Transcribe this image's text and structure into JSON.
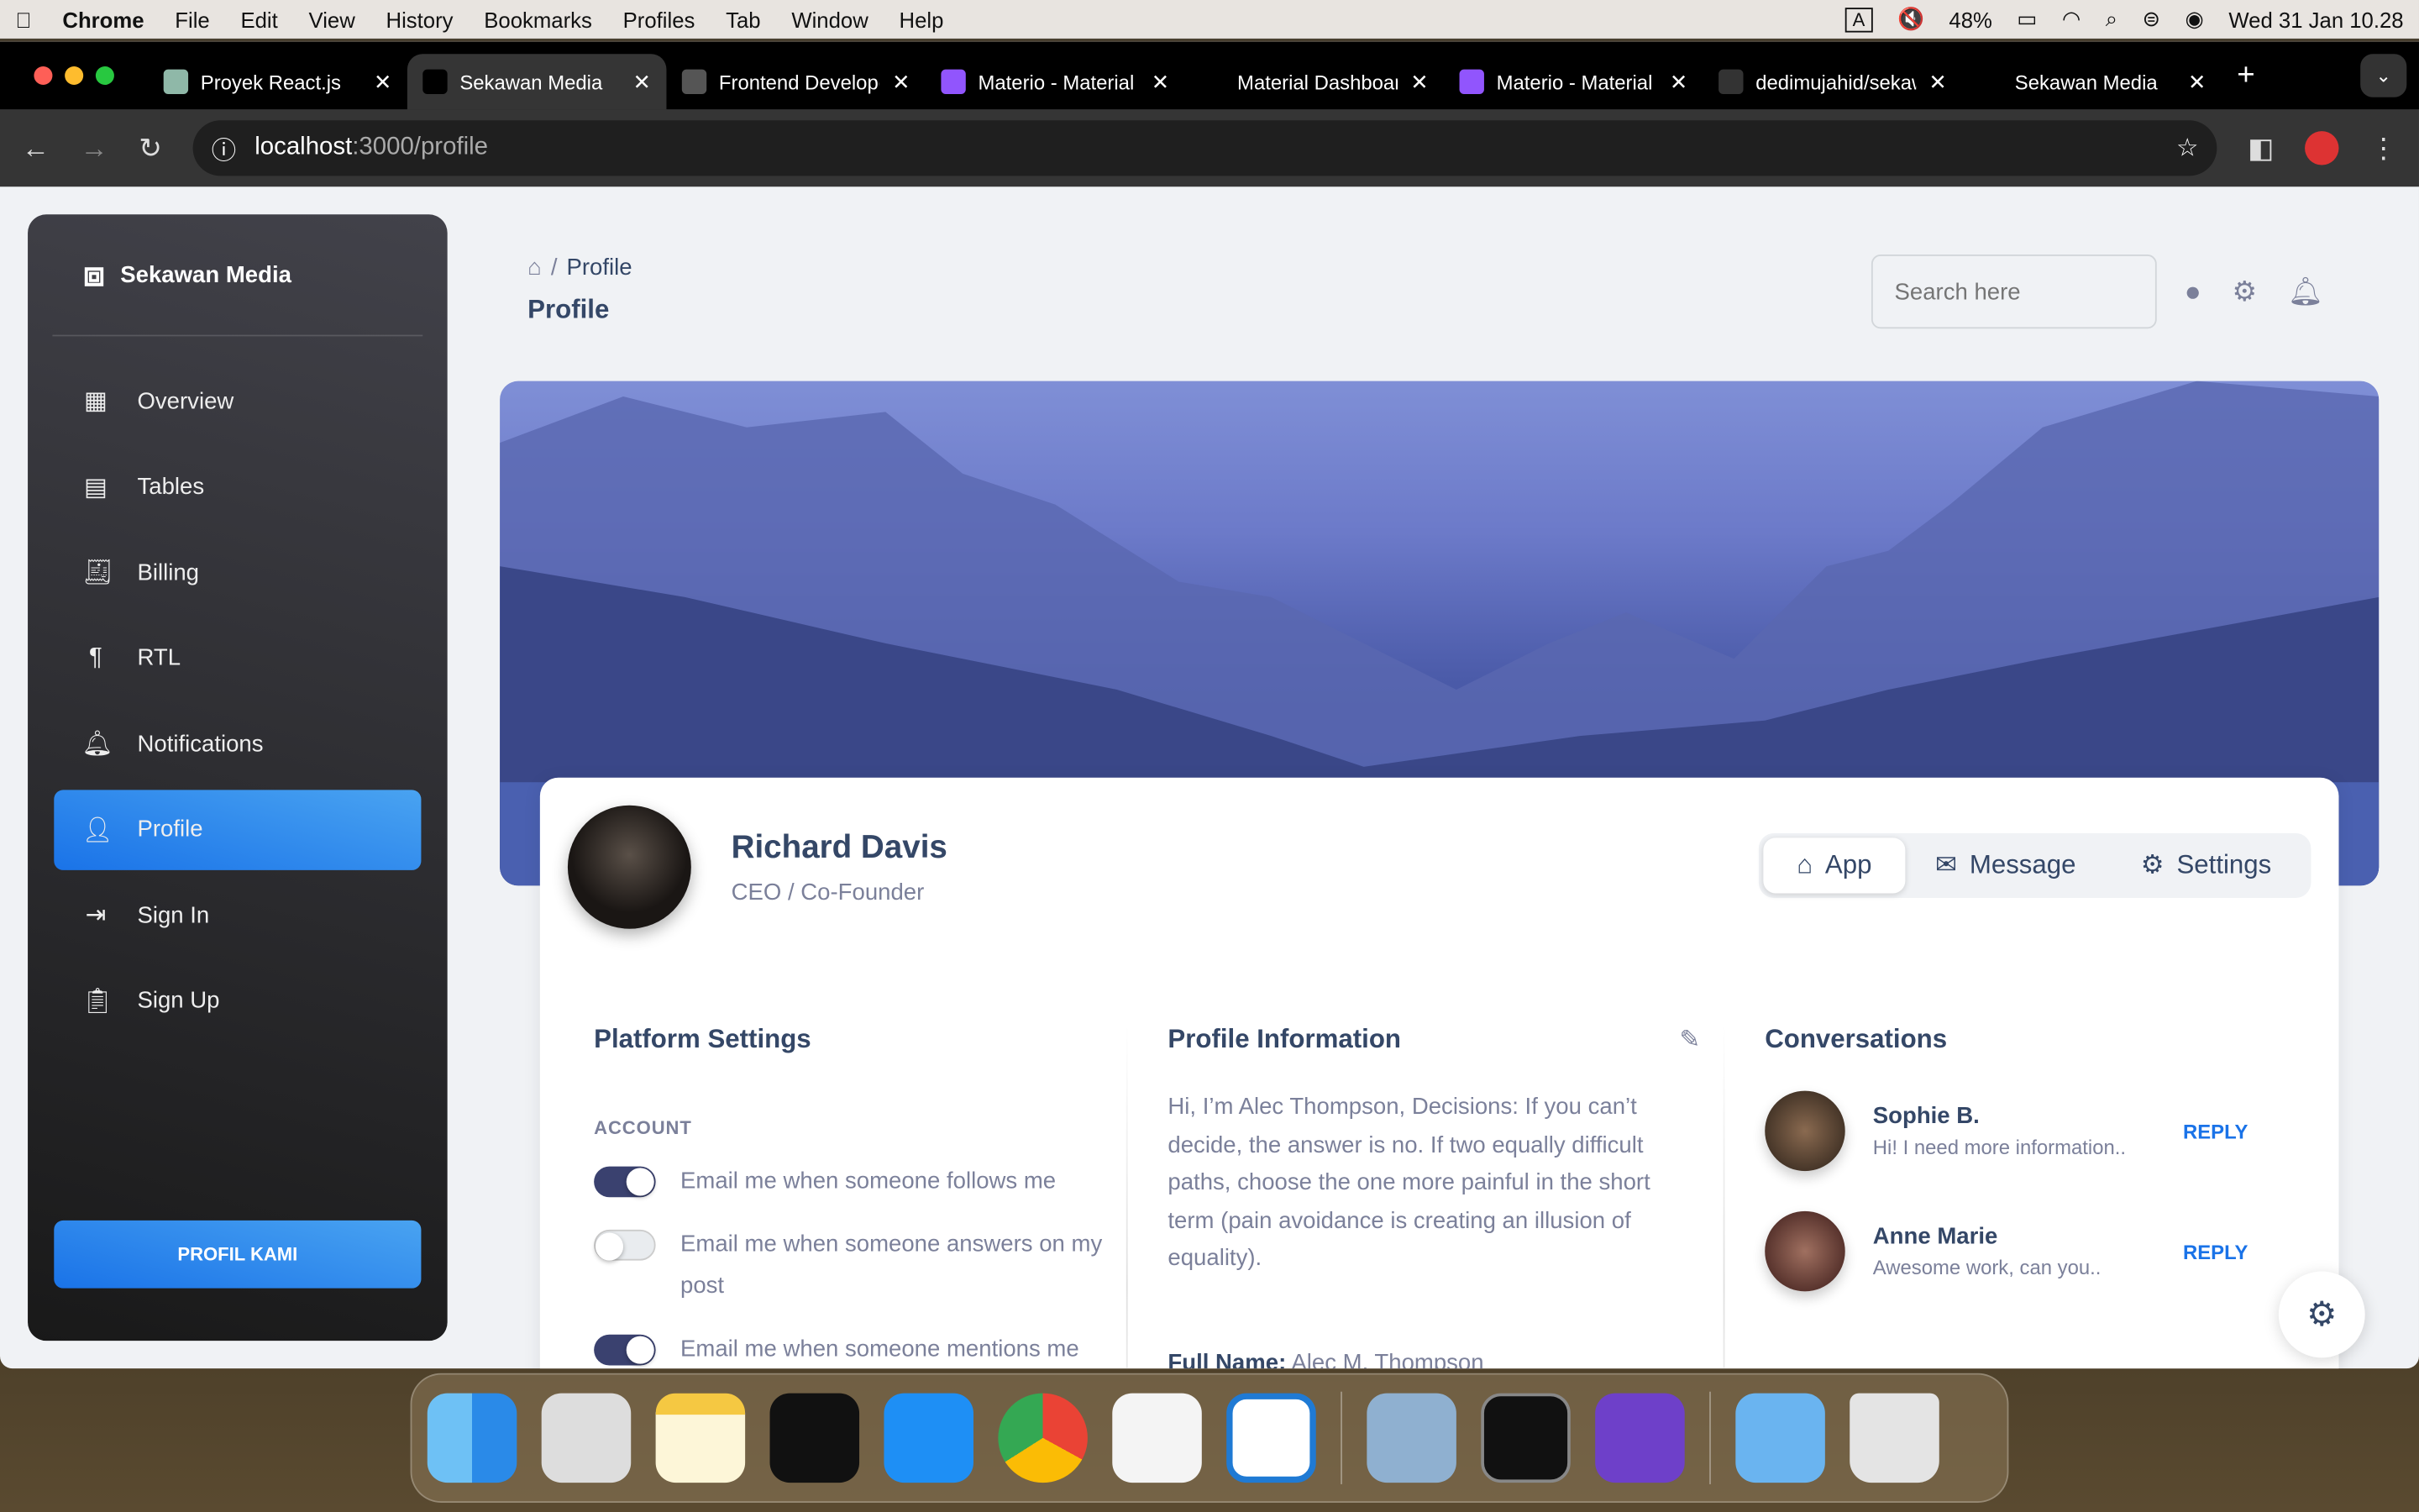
{
  "menubar": {
    "app": "Chrome",
    "items": [
      "File",
      "Edit",
      "View",
      "History",
      "Bookmarks",
      "Profiles",
      "Tab",
      "Window",
      "Help"
    ],
    "input_indicator": "A",
    "battery": "48%",
    "datetime": "Wed 31 Jan  10.28"
  },
  "browser": {
    "tabs": [
      {
        "label": "Proyek React.js",
        "color": "#8fb8a8"
      },
      {
        "label": "Sekawan Media",
        "color": "#000000",
        "active": true
      },
      {
        "label": "Frontend Developer",
        "color": "#555555"
      },
      {
        "label": "Materio - Material",
        "color": "#9155fd"
      },
      {
        "label": "Material Dashboard",
        "color": "#000000"
      },
      {
        "label": "Materio - Material",
        "color": "#9155fd"
      },
      {
        "label": "dedimujahid/sekawan",
        "color": "#333333"
      },
      {
        "label": "Sekawan Media",
        "color": "#000000"
      }
    ],
    "url_host": "localhost",
    "url_path": ":3000/profile"
  },
  "sidebar": {
    "brand": "Sekawan Media",
    "items": [
      {
        "label": "Overview",
        "icon": "dashboard-icon"
      },
      {
        "label": "Tables",
        "icon": "table-icon"
      },
      {
        "label": "Billing",
        "icon": "receipt-icon"
      },
      {
        "label": "RTL",
        "icon": "format-rtl-icon"
      },
      {
        "label": "Notifications",
        "icon": "bell-icon"
      },
      {
        "label": "Profile",
        "icon": "person-icon",
        "active": true
      },
      {
        "label": "Sign In",
        "icon": "login-icon"
      },
      {
        "label": "Sign Up",
        "icon": "assignment-icon"
      }
    ],
    "cta": "PROFIL KAMI"
  },
  "header": {
    "breadcrumb_current": "Profile",
    "breadcrumb_sep": "/",
    "title": "Profile",
    "search_placeholder": "Search here"
  },
  "profile": {
    "name": "Richard Davis",
    "role": "CEO / Co-Founder",
    "tabs": [
      "App",
      "Message",
      "Settings"
    ]
  },
  "platform_settings": {
    "title": "Platform Settings",
    "section": "ACCOUNT",
    "toggles": [
      {
        "label": "Email me when someone follows me",
        "on": true
      },
      {
        "label": "Email me when someone answers on my post",
        "on": false
      },
      {
        "label": "Email me when someone mentions me",
        "on": true
      }
    ]
  },
  "profile_info": {
    "title": "Profile Information",
    "bio": "Hi, I’m Alec Thompson, Decisions: If you can’t decide, the answer is no. If two equally difficult paths, choose the one more painful in the short term (pain avoidance is creating an illusion of equality).",
    "full_name_label": "Full Name:",
    "full_name": "Alec M. Thompson"
  },
  "conversations": {
    "title": "Conversations",
    "items": [
      {
        "name": "Sophie B.",
        "message": "Hi! I need more information..",
        "action": "REPLY"
      },
      {
        "name": "Anne Marie",
        "message": "Awesome work, can you..",
        "action": "REPLY"
      }
    ]
  }
}
